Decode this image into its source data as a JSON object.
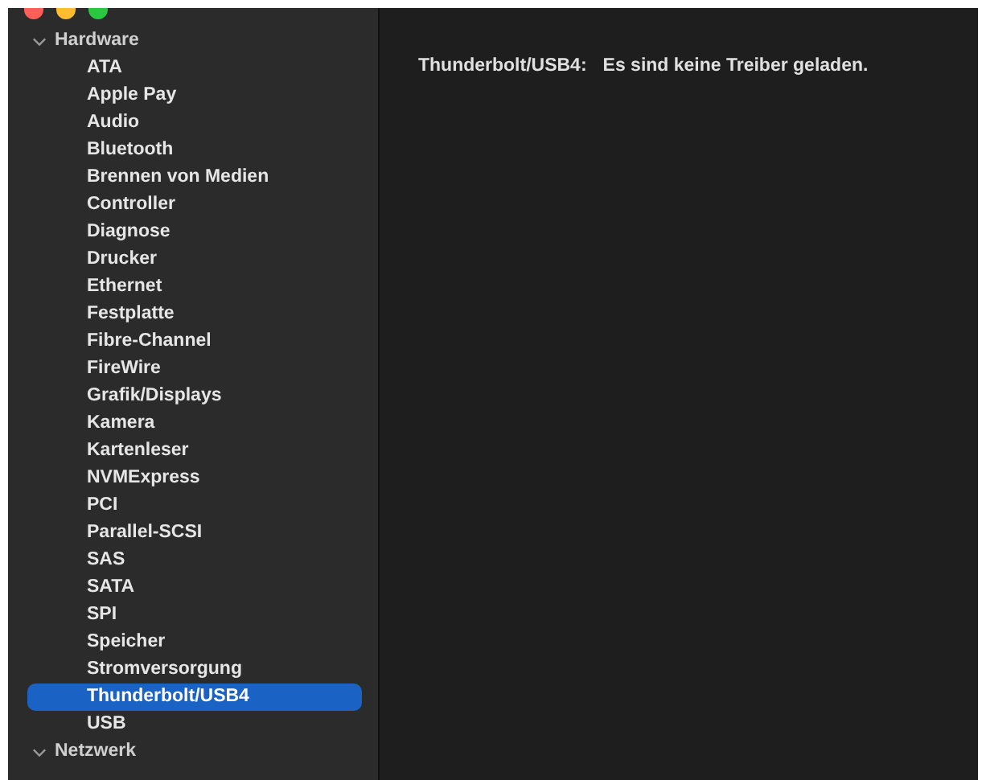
{
  "sidebar": {
    "sections": [
      {
        "label": "Hardware",
        "expanded": true,
        "items": [
          {
            "label": "ATA",
            "selected": false
          },
          {
            "label": "Apple Pay",
            "selected": false
          },
          {
            "label": "Audio",
            "selected": false
          },
          {
            "label": "Bluetooth",
            "selected": false
          },
          {
            "label": "Brennen von Medien",
            "selected": false
          },
          {
            "label": "Controller",
            "selected": false
          },
          {
            "label": "Diagnose",
            "selected": false
          },
          {
            "label": "Drucker",
            "selected": false
          },
          {
            "label": "Ethernet",
            "selected": false
          },
          {
            "label": "Festplatte",
            "selected": false
          },
          {
            "label": "Fibre-Channel",
            "selected": false
          },
          {
            "label": "FireWire",
            "selected": false
          },
          {
            "label": "Grafik/Displays",
            "selected": false
          },
          {
            "label": "Kamera",
            "selected": false
          },
          {
            "label": "Kartenleser",
            "selected": false
          },
          {
            "label": "NVMExpress",
            "selected": false
          },
          {
            "label": "PCI",
            "selected": false
          },
          {
            "label": "Parallel-SCSI",
            "selected": false
          },
          {
            "label": "SAS",
            "selected": false
          },
          {
            "label": "SATA",
            "selected": false
          },
          {
            "label": "SPI",
            "selected": false
          },
          {
            "label": "Speicher",
            "selected": false
          },
          {
            "label": "Stromversorgung",
            "selected": false
          },
          {
            "label": "Thunderbolt/USB4",
            "selected": true
          },
          {
            "label": "USB",
            "selected": false
          }
        ]
      },
      {
        "label": "Netzwerk",
        "expanded": true
      }
    ]
  },
  "content": {
    "label": "Thunderbolt/USB4:",
    "message": "Es sind keine Treiber geladen."
  }
}
